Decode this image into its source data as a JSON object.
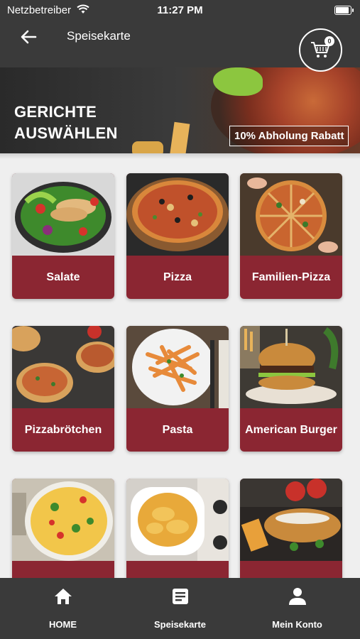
{
  "status_bar": {
    "carrier": "Netzbetreiber",
    "time": "11:27 PM"
  },
  "header": {
    "title": "Speisekarte",
    "cart_count": "0"
  },
  "banner": {
    "heading_line1": "GERICHTE",
    "heading_line2": "AUSWÄHLEN",
    "promo": "10% Abholung Rabatt"
  },
  "categories": [
    {
      "label": "Salate"
    },
    {
      "label": "Pizza"
    },
    {
      "label": "Familien-Pizza"
    },
    {
      "label": "Pizzabrötchen"
    },
    {
      "label": "Pasta"
    },
    {
      "label": "American Burger"
    },
    {
      "label": ""
    },
    {
      "label": ""
    },
    {
      "label": ""
    }
  ],
  "nav": [
    {
      "label": "HOME",
      "icon": "home-icon"
    },
    {
      "label": "Speisekarte",
      "icon": "menu-icon"
    },
    {
      "label": "Mein Konto",
      "icon": "account-icon"
    }
  ],
  "colors": {
    "header_bg": "#3a3a3a",
    "card_accent": "#8b2632",
    "background": "#efefef"
  }
}
